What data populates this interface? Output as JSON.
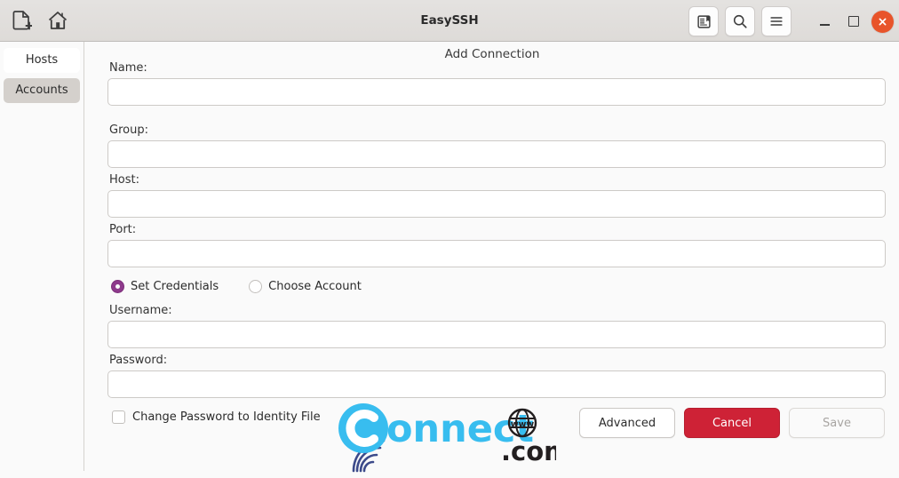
{
  "window": {
    "title": "EasySSH",
    "titlebar_left_icons": [
      {
        "name": "new-connection-icon",
        "glyph": "document-plus"
      },
      {
        "name": "home-icon",
        "glyph": "home"
      }
    ],
    "titlebar_right_buttons": [
      {
        "name": "terminal-book-button",
        "glyph": "book"
      },
      {
        "name": "search-button",
        "glyph": "search"
      },
      {
        "name": "menu-button",
        "glyph": "hamburger"
      }
    ],
    "window_controls": {
      "minimize": "–",
      "maximize": "□",
      "close": "✕",
      "close_color": "#e8542a"
    }
  },
  "sidebar": {
    "items": [
      {
        "label": "Hosts",
        "state": "plain"
      },
      {
        "label": "Accounts",
        "state": "selected"
      }
    ]
  },
  "main": {
    "title": "Add Connection",
    "fields": [
      {
        "label": "Name:",
        "value": "",
        "placeholder": "",
        "name": "name"
      },
      {
        "label": "Group:",
        "value": "",
        "placeholder": "",
        "name": "group"
      },
      {
        "label": "Host:",
        "value": "",
        "placeholder": "",
        "name": "host"
      },
      {
        "label": "Port:",
        "value": "",
        "placeholder": "",
        "name": "port"
      }
    ],
    "credential_mode": {
      "options": [
        {
          "label": "Set Credentials",
          "selected": true
        },
        {
          "label": "Choose Account",
          "selected": false
        }
      ],
      "selected_color": "#8e3a8c"
    },
    "credential_fields": [
      {
        "label": "Username:",
        "value": "",
        "placeholder": "",
        "name": "username"
      },
      {
        "label": "Password:",
        "value": "",
        "placeholder": "",
        "name": "password"
      }
    ],
    "identity_checkbox": {
      "label": "Change Password to Identity File",
      "checked": false
    },
    "buttons": [
      {
        "label": "Advanced",
        "style": "normal"
      },
      {
        "label": "Cancel",
        "style": "danger"
      },
      {
        "label": "Save",
        "style": "disabled"
      }
    ]
  },
  "watermark": {
    "text": "Connect",
    "suffix": ".com",
    "globe_text": "www",
    "color": "#38bdef",
    "dark_color": "#231f20"
  }
}
